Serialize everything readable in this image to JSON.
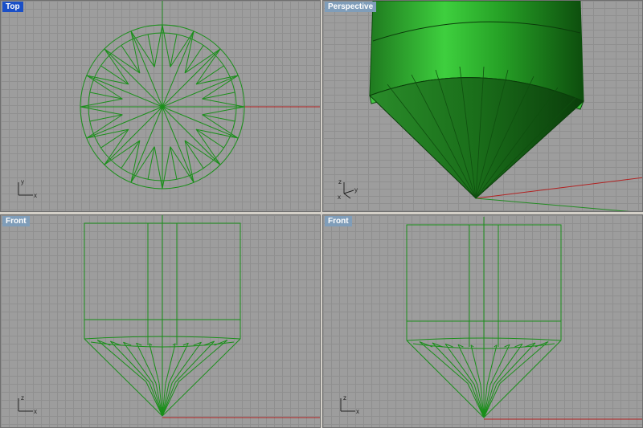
{
  "viewports": {
    "top": {
      "title": "Top",
      "active": true
    },
    "perspective": {
      "title": "Perspective",
      "active": false
    },
    "front_left": {
      "title": "Front",
      "active": false
    },
    "front_right": {
      "title": "Front",
      "active": false
    }
  },
  "axes": {
    "x_label": "x",
    "y_label": "y",
    "z_label": "z"
  },
  "colors": {
    "background": "#9d9d9d",
    "grid": "#8f8f8f",
    "wire": "#1a8f1a",
    "x_axis": "#b22222",
    "y_axis": "#228b22",
    "active_title": "#1a4fc7",
    "inactive_title": "#7f9db9"
  }
}
